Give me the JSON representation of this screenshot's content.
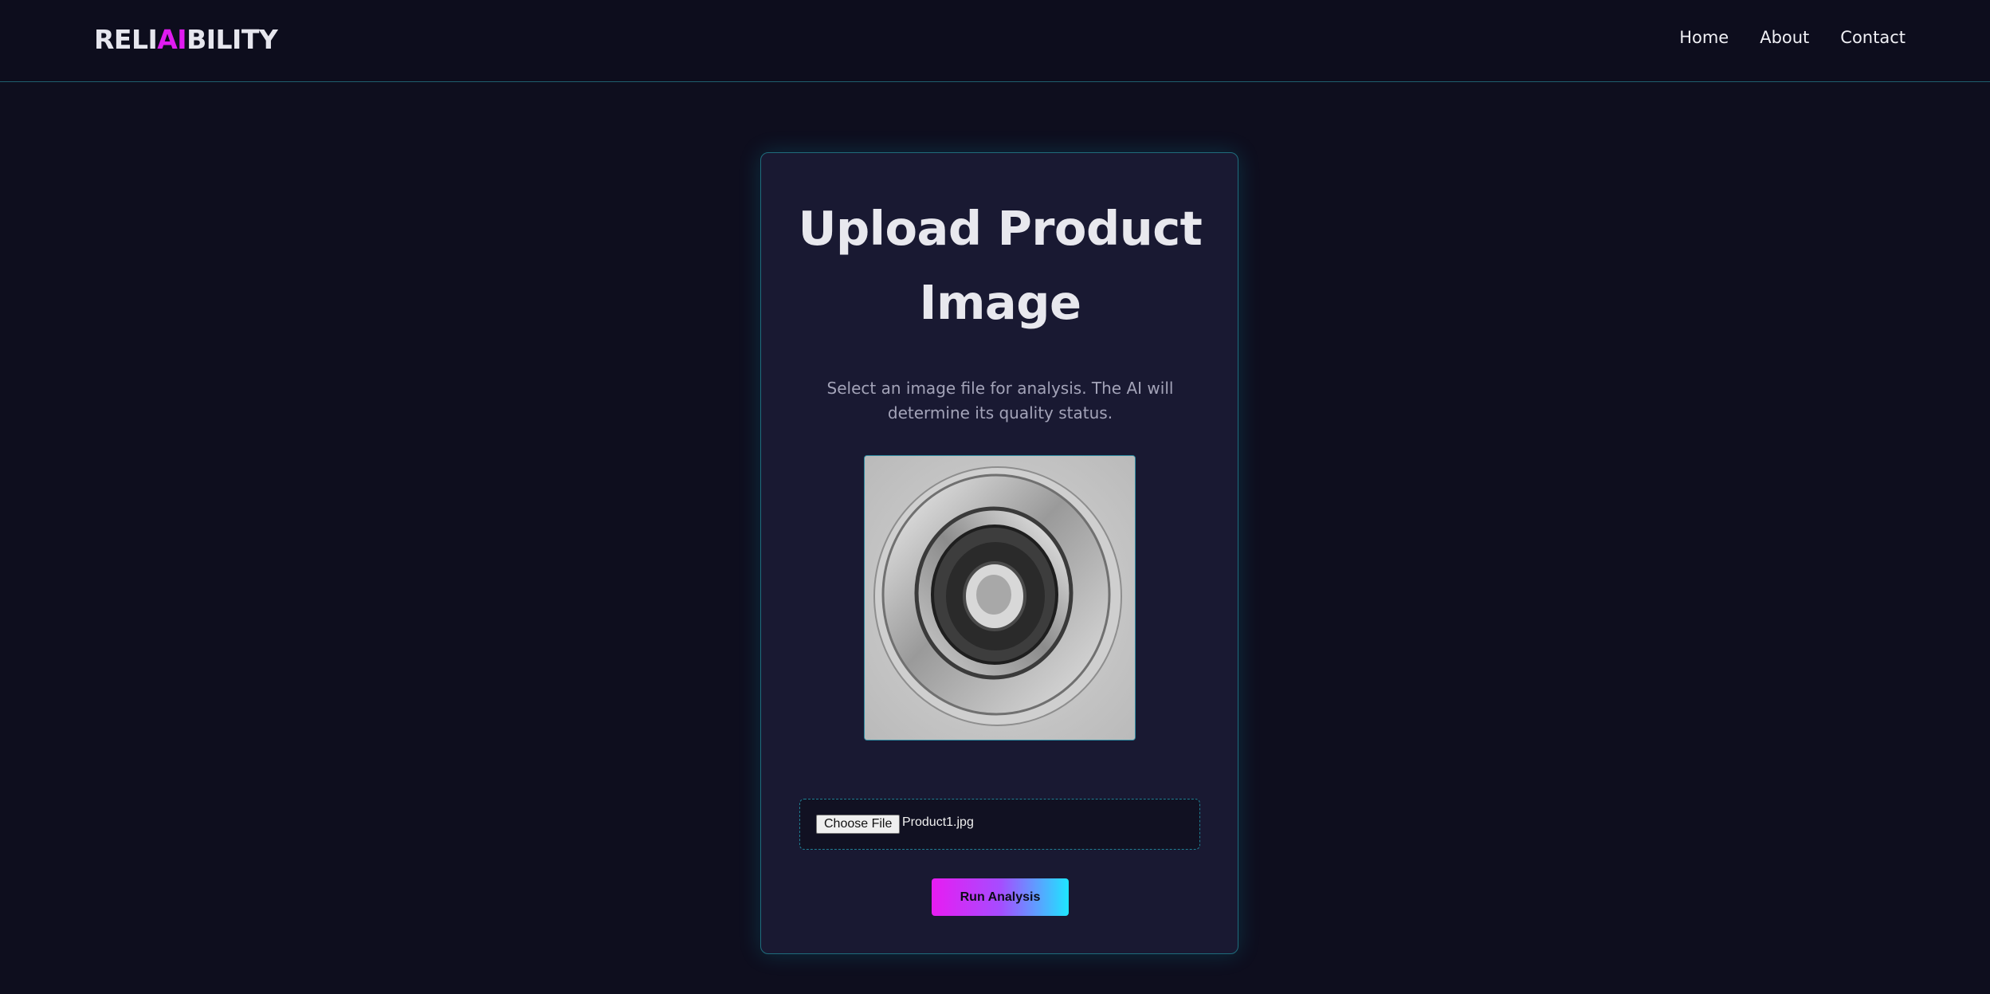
{
  "header": {
    "logo_parts": [
      "RELI",
      "AI",
      "BILITY"
    ],
    "nav": [
      "Home",
      "About",
      "Contact"
    ]
  },
  "upload_card": {
    "title": "Upload Product Image",
    "subtitle": "Select an image file for analysis. The AI will determine its quality status.",
    "preview_image": "product-image-preview",
    "file_input": {
      "button_label": "Choose File",
      "selected_file": "Product1.jpg"
    },
    "run_button": "Run Analysis"
  },
  "colors": {
    "background": "#0e0e1e",
    "card": "#191932",
    "accent_magenta": "#e01bf0",
    "accent_cyan": "#1ee6ff",
    "border": "#1f6c7c"
  }
}
